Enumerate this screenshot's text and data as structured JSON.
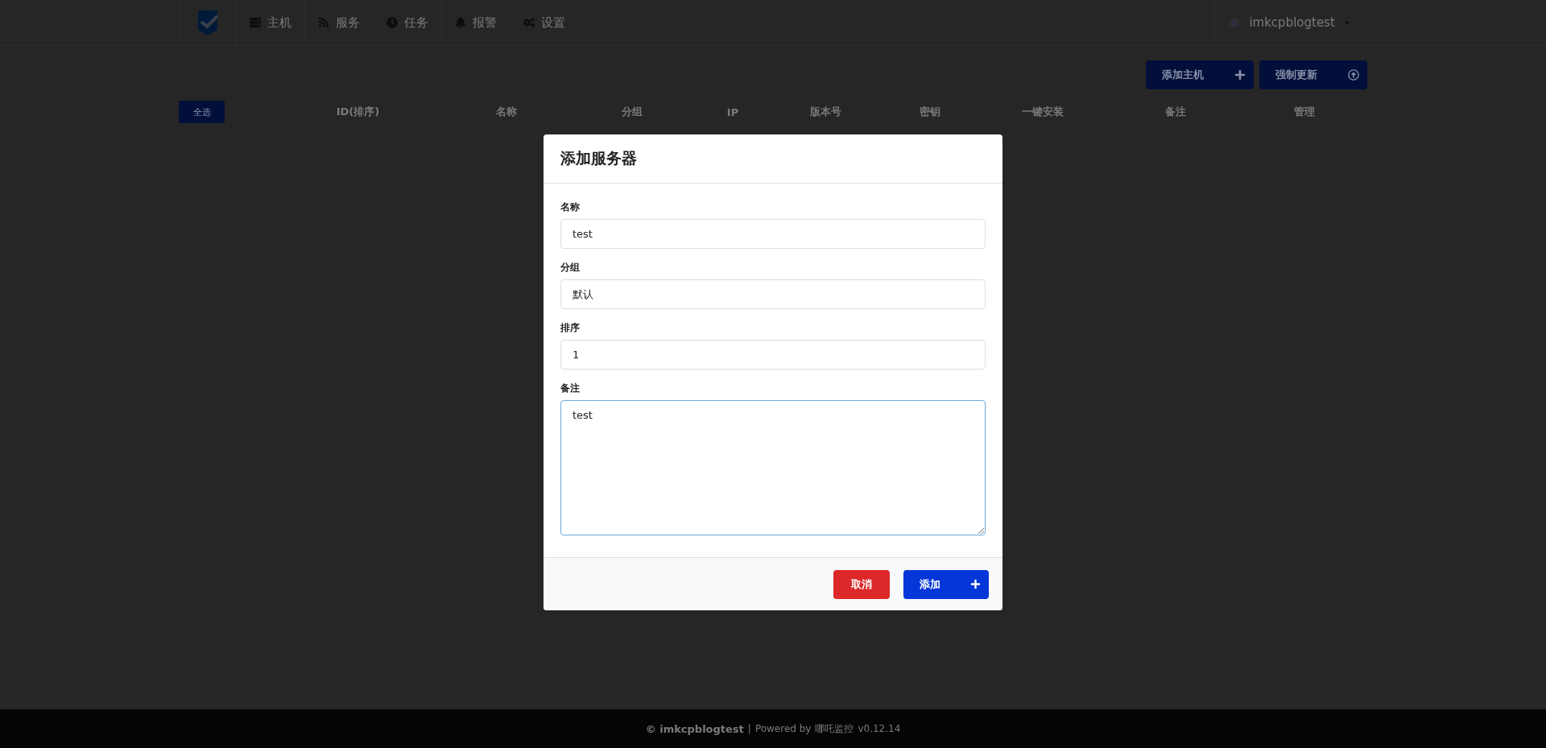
{
  "nav": {
    "items": [
      {
        "label": "主机"
      },
      {
        "label": "服务"
      },
      {
        "label": "任务"
      },
      {
        "label": "报警"
      },
      {
        "label": "设置"
      }
    ],
    "user": "imkcpblogtest"
  },
  "toolbar": {
    "buttons": [
      {
        "label": "添加主机"
      },
      {
        "label": "强制更新"
      }
    ]
  },
  "table": {
    "select_all": "全选",
    "columns": [
      "ID(排序)",
      "名称",
      "分组",
      "IP",
      "版本号",
      "密钥",
      "一键安装",
      "备注",
      "管理"
    ]
  },
  "dialog": {
    "title": "添加服务器",
    "fields": [
      {
        "label": "名称",
        "value": "test",
        "kind": "input",
        "focused": false
      },
      {
        "label": "分组",
        "value": "默认",
        "kind": "input",
        "focused": false
      },
      {
        "label": "排序",
        "value": "1",
        "kind": "input",
        "focused": false
      },
      {
        "label": "备注",
        "value": "test",
        "kind": "textarea",
        "focused": true
      }
    ],
    "cancel": "取消",
    "submit": "添加"
  },
  "footer": {
    "owner": "© imkcpblogtest",
    "separator": "|",
    "powered": "Powered by",
    "link": "哪吒监控",
    "version": "v0.12.14"
  }
}
